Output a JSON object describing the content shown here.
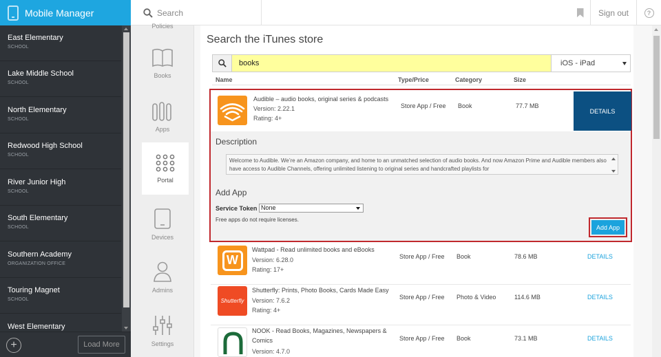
{
  "header": {
    "app_title": "Mobile Manager",
    "search_label": "Search",
    "signout_label": "Sign out",
    "help_label": "?"
  },
  "sidebar": {
    "schools": [
      {
        "name": "East Elementary",
        "type": "SCHOOL"
      },
      {
        "name": "Lake Middle School",
        "type": "SCHOOL"
      },
      {
        "name": "North Elementary",
        "type": "SCHOOL"
      },
      {
        "name": "Redwood High School",
        "type": "SCHOOL"
      },
      {
        "name": "River Junior High",
        "type": "SCHOOL"
      },
      {
        "name": "South Elementary",
        "type": "SCHOOL"
      },
      {
        "name": "Southern Academy",
        "type": "ORGANIZATION OFFICE"
      },
      {
        "name": "Touring Magnet",
        "type": "SCHOOL"
      },
      {
        "name": "West Elementary",
        "type": ""
      }
    ],
    "add_symbol": "+",
    "load_more_label": "Load More"
  },
  "modules": {
    "policies_label": "Policies",
    "items": [
      {
        "label": "Books",
        "icon": "books-icon"
      },
      {
        "label": "Apps",
        "icon": "apps-icon"
      },
      {
        "label": "Portal",
        "icon": "portal-icon"
      },
      {
        "label": "Devices",
        "icon": "devices-icon"
      },
      {
        "label": "Admins",
        "icon": "admins-icon"
      },
      {
        "label": "Settings",
        "icon": "settings-icon"
      }
    ],
    "active": "Portal"
  },
  "store": {
    "title": "Search the iTunes store",
    "query": "books",
    "device_filter": "iOS - iPad",
    "columns": {
      "name": "Name",
      "type_price": "Type/Price",
      "category": "Category",
      "size": "Size"
    }
  },
  "selected_app": {
    "name": "Audible – audio books, original series & podcasts",
    "version": "Version: 2.22.1",
    "rating": "Rating: 4+",
    "type_price": "Store App / Free",
    "category": "Book",
    "size": "77.7 MB",
    "details_label": "DETAILS",
    "description_heading": "Description",
    "description_text": "Welcome to Audible. We’re an Amazon company, and home to an unmatched selection of audio books. And now Amazon Prime and Audible members also have access to Audible Channels, offering unlimited listening to original series and handcrafted playlists for",
    "add_app_heading": "Add App",
    "service_token_label": "Service Token",
    "service_token_value": "None",
    "free_note": "Free apps do not require licenses.",
    "add_app_button": "Add App"
  },
  "results": [
    {
      "name": "Wattpad - Read unlimited books and eBooks",
      "version": "Version: 6.28.0",
      "rating": "Rating: 17+",
      "type_price": "Store App / Free",
      "category": "Book",
      "size": "78.6 MB",
      "details_label": "DETAILS",
      "icon": "wattpad-icon",
      "icon_text": "W"
    },
    {
      "name": "Shutterfly: Prints, Photo Books, Cards Made Easy",
      "version": "Version: 7.6.2",
      "rating": "Rating: 4+",
      "type_price": "Store App / Free",
      "category": "Photo & Video",
      "size": "114.6 MB",
      "details_label": "DETAILS",
      "icon": "shutterfly-icon",
      "icon_text": "Shutterfly"
    },
    {
      "name": "NOOK - Read Books, Magazines, Newspapers & Comics",
      "version": "Version: 4.7.0",
      "rating": "",
      "type_price": "Store App / Free",
      "category": "Book",
      "size": "73.1 MB",
      "details_label": "DETAILS",
      "icon": "nook-icon",
      "icon_text": ""
    }
  ],
  "colors": {
    "brand": "#1ea6e0",
    "sidebar_bg": "#2f3338",
    "details_dark": "#0c5082",
    "add_app_blue": "#1ba3dd",
    "highlight_red": "#c0282d",
    "search_yellow": "#ffff9d"
  }
}
